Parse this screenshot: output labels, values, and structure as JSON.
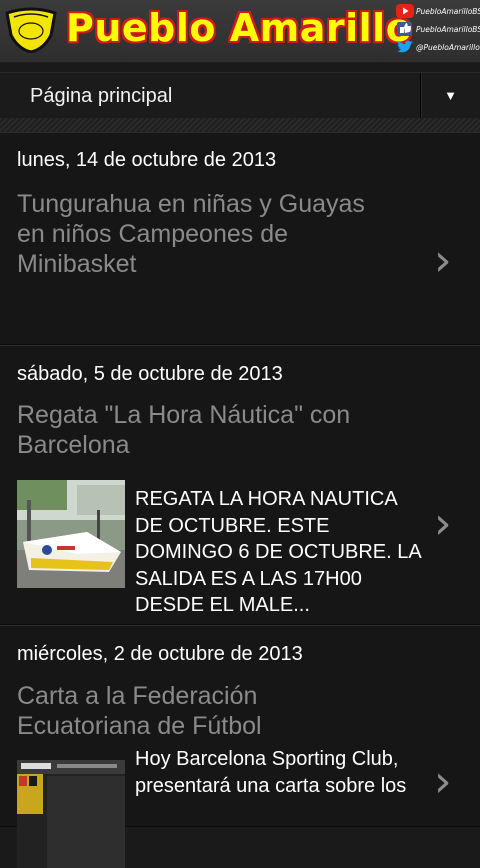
{
  "header": {
    "site_title": "Pueblo Amarillo",
    "social": [
      {
        "icon": "youtube-icon",
        "handle": "PuebloAmarilloBSC"
      },
      {
        "icon": "facebook-icon",
        "handle": "PuebloAmarilloBSC"
      },
      {
        "icon": "twitter-icon",
        "handle": "@PuebloAmarillo"
      }
    ]
  },
  "nav": {
    "label": "Página principal",
    "dropdown_icon": "▼"
  },
  "posts": [
    {
      "date": "lunes, 14 de octubre de 2013",
      "title": "Tungurahua en niñas y Guayas en niños Campeones de Minibasket",
      "snippet": "",
      "chevron": "›"
    },
    {
      "date": "sábado, 5 de octubre de 2013",
      "title": "Regata \"La Hora Náutica\" con Barcelona",
      "snippet": "REGATA LA HORA NAUTICA DE OCTUBRE. ESTE DOMINGO 6 DE OCTUBRE. LA SALIDA ES A LAS 17H00 DESDE EL MALE...",
      "chevron": "›"
    },
    {
      "date": "miércoles, 2 de octubre de 2013",
      "title": "Carta a la Federación Ecuatoriana de Fútbol",
      "snippet": "Hoy Barcelona Sporting Club, presentará una carta sobre los",
      "chevron": "›"
    }
  ],
  "colors": {
    "title_yellow": "#ffff00",
    "title_outline": "#d11919",
    "post_title": "#8a8a8a"
  }
}
